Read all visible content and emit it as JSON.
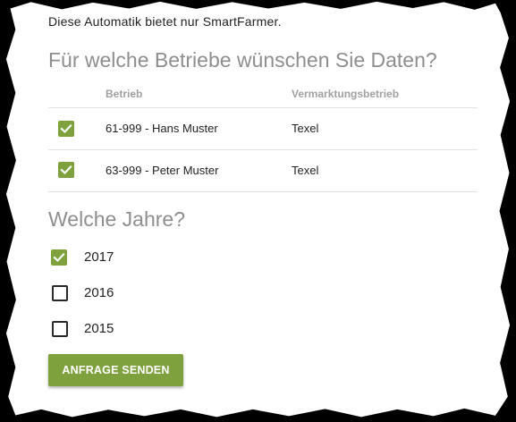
{
  "intro_text": "Diese Automatik bietet nur SmartFarmer.",
  "question_farms": "Für welche Betriebe wünschen Sie Daten?",
  "table": {
    "headers": {
      "betrieb": "Betrieb",
      "vermarktung": "Vermarktungsbetrieb"
    },
    "rows": [
      {
        "betrieb": "61-999 - Hans Muster",
        "vermarktung": "Texel",
        "checked": true
      },
      {
        "betrieb": "63-999 - Peter Muster",
        "vermarktung": "Texel",
        "checked": true
      }
    ]
  },
  "question_years": "Welche Jahre?",
  "years": [
    {
      "label": "2017",
      "checked": true
    },
    {
      "label": "2016",
      "checked": false
    },
    {
      "label": "2015",
      "checked": false
    }
  ],
  "submit_label": "ANFRAGE SENDEN",
  "colors": {
    "accent": "#7ea13d",
    "heading": "#8e8e8e",
    "background": "#000000"
  },
  "icons": {
    "checked": "checkmark-icon"
  }
}
